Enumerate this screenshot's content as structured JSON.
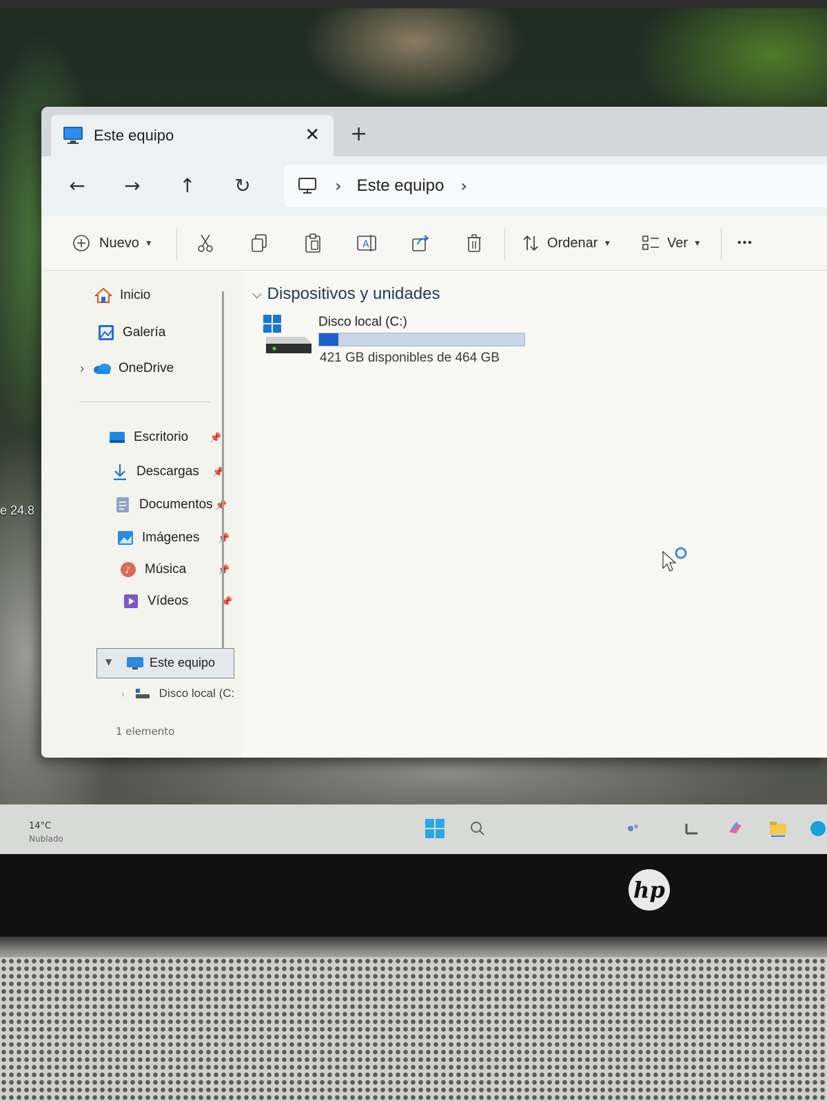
{
  "desktop": {
    "partial_label": "e 24.8"
  },
  "window": {
    "tab": {
      "title": "Este equipo",
      "close_glyph": "✕",
      "new_tab_glyph": "+"
    },
    "nav": {
      "back_glyph": "←",
      "forward_glyph": "→",
      "up_glyph": "↑",
      "refresh_glyph": "↻",
      "breadcrumb": "Este equipo",
      "chevron": "›"
    },
    "toolbar": {
      "new_label": "Nuevo",
      "sort_label": "Ordenar",
      "view_label": "Ver",
      "more_glyph": "•••"
    },
    "sidebar": {
      "home": "Inicio",
      "gallery": "Galería",
      "onedrive": "OneDrive",
      "quick_access": [
        {
          "label": "Escritorio",
          "icon": "desktop-folder-icon"
        },
        {
          "label": "Descargas",
          "icon": "download-icon"
        },
        {
          "label": "Documentos",
          "icon": "documents-icon"
        },
        {
          "label": "Imágenes",
          "icon": "pictures-icon"
        },
        {
          "label": "Música",
          "icon": "music-icon"
        },
        {
          "label": "Vídeos",
          "icon": "videos-icon"
        }
      ],
      "this_pc": "Este equipo",
      "local_disk": "Disco local (C:",
      "status": "1 elemento"
    },
    "content": {
      "group_title": "Dispositivos y unidades",
      "drives": [
        {
          "name": "Disco local (C:)",
          "free_text": "421 GB disponibles de 464 GB",
          "used_fraction": 0.093
        }
      ]
    }
  },
  "taskbar": {
    "temperature": "14°C",
    "weather": "Nublado"
  },
  "laptop": {
    "brand": "hp"
  },
  "colors": {
    "accent": "#1f5fcc",
    "header_text": "#243a59",
    "windows_blue": "#0a74da"
  }
}
